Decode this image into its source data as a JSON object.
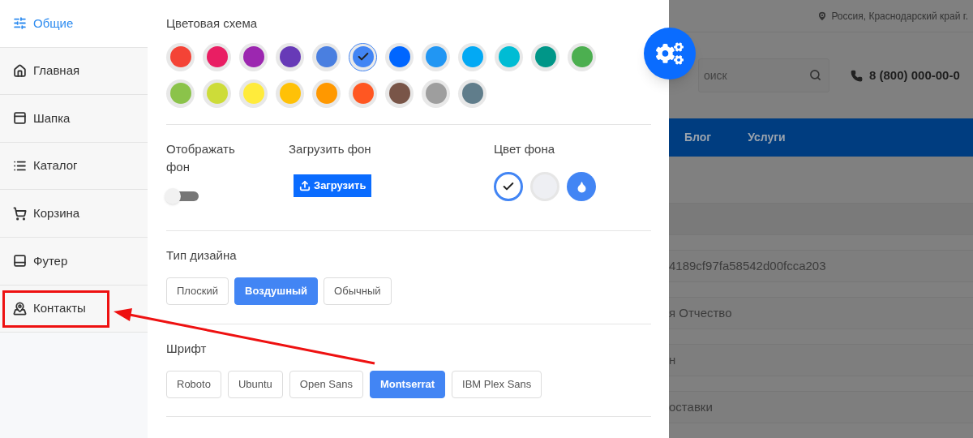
{
  "sidebar": {
    "items": [
      {
        "label": "Общие",
        "selected": true
      },
      {
        "label": "Главная",
        "selected": false
      },
      {
        "label": "Шапка",
        "selected": false
      },
      {
        "label": "Каталог",
        "selected": false
      },
      {
        "label": "Корзина",
        "selected": false
      },
      {
        "label": "Футер",
        "selected": false
      },
      {
        "label": "Контакты",
        "selected": false
      }
    ]
  },
  "settings": {
    "color_scheme": {
      "title": "Цветовая схема",
      "swatches": [
        {
          "color": "#f44336",
          "selected": false
        },
        {
          "color": "#e91e63",
          "selected": false
        },
        {
          "color": "#9c27b0",
          "selected": false
        },
        {
          "color": "#673ab7",
          "selected": false
        },
        {
          "color": "#4a7fe0",
          "selected": false
        },
        {
          "color": "#4285f4",
          "selected": true
        },
        {
          "color": "#0066ff",
          "selected": false
        },
        {
          "color": "#2196f3",
          "selected": false
        },
        {
          "color": "#03a9f4",
          "selected": false
        },
        {
          "color": "#00bcd4",
          "selected": false
        },
        {
          "color": "#009688",
          "selected": false
        },
        {
          "color": "#4caf50",
          "selected": false
        },
        {
          "color": "#8bc34a",
          "selected": false
        },
        {
          "color": "#cddc39",
          "selected": false
        },
        {
          "color": "#ffeb3b",
          "selected": false
        },
        {
          "color": "#ffc107",
          "selected": false
        },
        {
          "color": "#ff9800",
          "selected": false
        },
        {
          "color": "#ff5722",
          "selected": false
        },
        {
          "color": "#795548",
          "selected": false
        },
        {
          "color": "#9e9e9e",
          "selected": false
        },
        {
          "color": "#607d8b",
          "selected": false
        }
      ]
    },
    "background": {
      "show": {
        "label": "Отображать фон",
        "on": false
      },
      "upload": {
        "label": "Загрузить фон",
        "button": "Загрузить"
      },
      "color": {
        "label": "Цвет фона",
        "options": [
          {
            "kind": "swatch",
            "color": "#ffffff",
            "selected": true
          },
          {
            "kind": "swatch",
            "color": "#eeeff3",
            "selected": false
          },
          {
            "kind": "picker",
            "color": "#4285f4",
            "selected": false
          }
        ]
      }
    },
    "design_type": {
      "title": "Тип дизайна",
      "options": [
        {
          "label": "Плоский",
          "selected": false
        },
        {
          "label": "Воздушный",
          "selected": true
        },
        {
          "label": "Обычный",
          "selected": false
        }
      ]
    },
    "font": {
      "title": "Шрифт",
      "options": [
        {
          "label": "Roboto",
          "selected": false
        },
        {
          "label": "Ubuntu",
          "selected": false
        },
        {
          "label": "Open Sans",
          "selected": false
        },
        {
          "label": "Montserrat",
          "selected": true
        },
        {
          "label": "IBM Plex Sans",
          "selected": false
        }
      ]
    }
  },
  "page": {
    "location": "Россия, Краснодарский край г.",
    "search_placeholder": "оиск",
    "phone": "8 (800) 000-00-0",
    "nav": [
      "Блог",
      "Услуги"
    ],
    "rows": [
      "",
      "4189cf97fa58542d00fcca203",
      "я Отчество",
      "н",
      "оставки"
    ]
  }
}
